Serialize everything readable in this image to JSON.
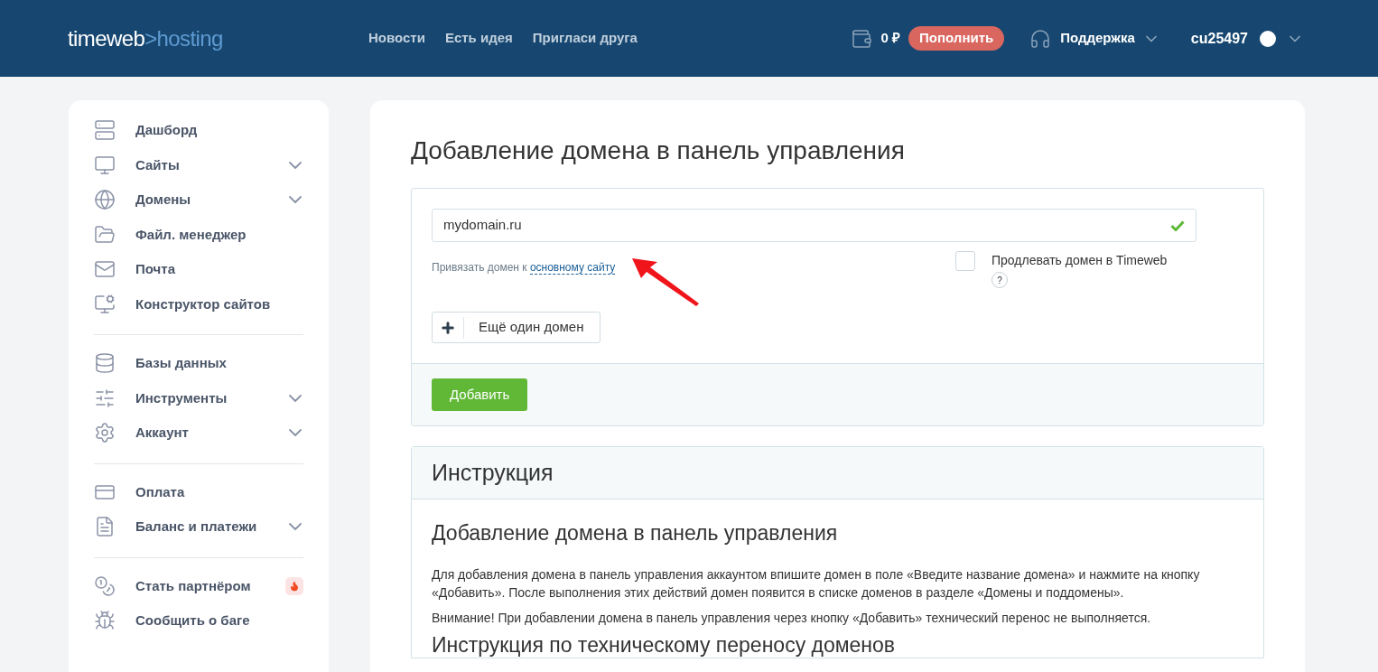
{
  "header": {
    "logo": {
      "name": "timeweb",
      "separator": ">",
      "product": "hosting"
    },
    "nav": [
      "Новости",
      "Есть идея",
      "Пригласи друга"
    ],
    "balance": "0 ₽",
    "topup": "Пополнить",
    "support": "Поддержка",
    "user": "cu25497"
  },
  "sidebar": {
    "groups": [
      [
        {
          "label": "Дашборд",
          "has_submenu": false,
          "badge": false
        },
        {
          "label": "Сайты",
          "has_submenu": true,
          "badge": false
        },
        {
          "label": "Домены",
          "has_submenu": true,
          "badge": false
        },
        {
          "label": "Файл. менеджер",
          "has_submenu": false,
          "badge": false
        },
        {
          "label": "Почта",
          "has_submenu": false,
          "badge": false
        },
        {
          "label": "Конструктор сайтов",
          "has_submenu": false,
          "badge": false
        }
      ],
      [
        {
          "label": "Базы данных",
          "has_submenu": false,
          "badge": false
        },
        {
          "label": "Инструменты",
          "has_submenu": true,
          "badge": false
        },
        {
          "label": "Аккаунт",
          "has_submenu": true,
          "badge": false
        }
      ],
      [
        {
          "label": "Оплата",
          "has_submenu": false,
          "badge": false
        },
        {
          "label": "Баланс и платежи",
          "has_submenu": true,
          "badge": false
        }
      ],
      [
        {
          "label": "Стать партнёром",
          "has_submenu": false,
          "badge": true
        },
        {
          "label": "Сообщить о баге",
          "has_submenu": false,
          "badge": false
        }
      ]
    ]
  },
  "page": {
    "title": "Добавление домена в панель управления",
    "form": {
      "domain_value": "mydomain.ru",
      "valid": true,
      "bind_hint": "Привязать домен к ",
      "bind_link": "основному сайту",
      "renew_label": "Продлевать домен в Timeweb",
      "renew_checked": false,
      "help": "?",
      "add_more": "Ещё один домен",
      "submit": "Добавить"
    },
    "instruction": {
      "title": "Инструкция",
      "heading": "Добавление домена в панель управления",
      "paragraphs": [
        "Для добавления домена в панель управления аккаунтом впишите домен в поле «Введите название домена» и нажмите на кнопку «Добавить». После выполнения этих действий домен появится в списке доменов в разделе «Домены и поддомены».",
        "Внимание! При добавлении домена в панель управления через кнопку «Добавить» технический перенос не выполняется."
      ],
      "heading2": "Инструкция по техническому переносу доменов"
    }
  }
}
